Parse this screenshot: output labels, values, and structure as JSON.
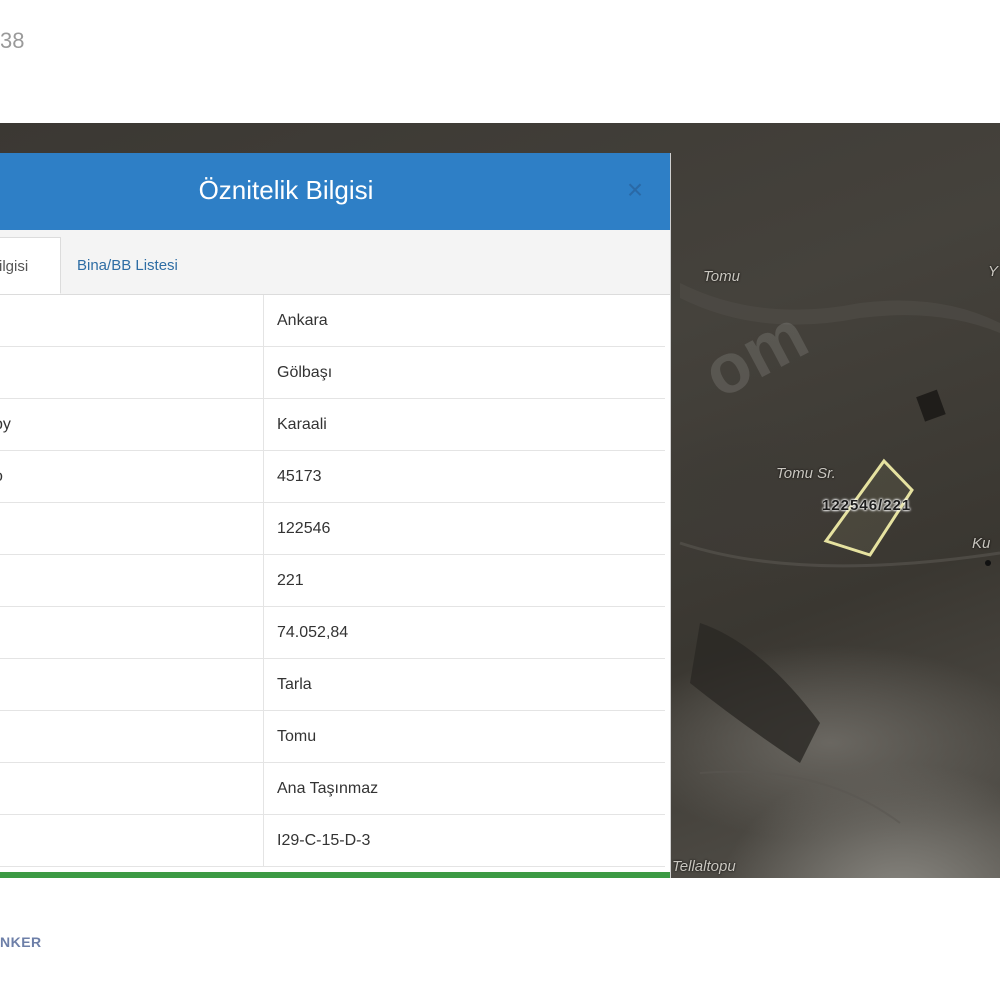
{
  "page": {
    "top_text": "38",
    "bottom_text": "NKER"
  },
  "panel": {
    "title": "Öznitelik Bilgisi",
    "close_symbol": "×",
    "tabs": [
      {
        "label": "Bilgisi",
        "active": true
      },
      {
        "label": "Bina/BB Listesi",
        "active": false
      }
    ],
    "rows": [
      {
        "key": "",
        "value": "Ankara"
      },
      {
        "key": "",
        "value": "Gölbaşı"
      },
      {
        "key": "by",
        "value": "Karaali"
      },
      {
        "key": "o",
        "value": "45173"
      },
      {
        "key": "",
        "value": "122546"
      },
      {
        "key": "",
        "value": "221"
      },
      {
        "key": "",
        "value": "74.052,84"
      },
      {
        "key": "",
        "value": "Tarla"
      },
      {
        "key": "",
        "value": "Tomu"
      },
      {
        "key": "",
        "value": "Ana Taşınmaz"
      },
      {
        "key": "",
        "value": "I29-C-15-D-3"
      }
    ]
  },
  "map": {
    "labels": {
      "tomu": "Tomu",
      "tomu_sr": "Tomu Sr.",
      "ku": "Ku",
      "y": "Y",
      "tellaltopu": "Tellaltopu"
    },
    "parcel_label": "122546/221",
    "watermark": "om"
  },
  "colors": {
    "header": "#2e7fc6",
    "accent_green": "#3c9a44",
    "parcel_outline": "#e6e2a0"
  }
}
